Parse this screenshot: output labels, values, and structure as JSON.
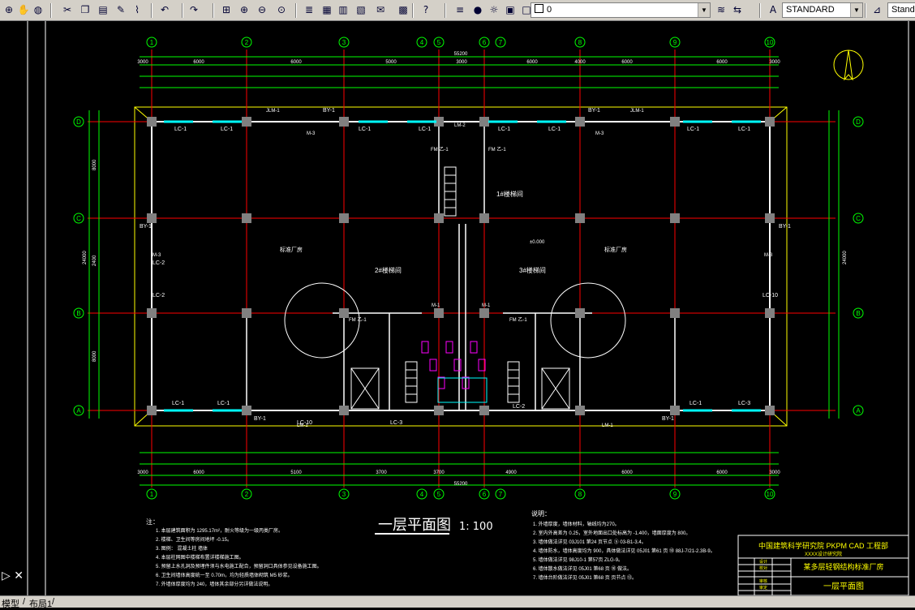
{
  "toolbar": {
    "layer_value": "0",
    "text_style": "STANDARD",
    "dim_style": "Stand",
    "icons": [
      "zoom-realtime-icon",
      "pan-icon",
      "globe-icon",
      "cut-icon",
      "copy-icon",
      "paste-icon",
      "match-properties-icon",
      "brush-icon",
      "undo-icon",
      "redo-icon",
      "zoom-window-icon",
      "zoom-in-icon",
      "zoom-out-icon",
      "zoom-previous-icon",
      "properties-icon",
      "design-center-icon",
      "tool-palette-icon",
      "sheet-set-icon",
      "markup-icon",
      "calculator-icon",
      "help-icon",
      "layer-manager-icon",
      "bulb-icon",
      "sun-icon",
      "lock-icon",
      "color-square-icon",
      "layer-state-icon",
      "layer-previous-icon",
      "text-style-icon",
      "dim-style-icon"
    ]
  },
  "status": {
    "model_tab": "模型",
    "layout_tab": "布局1"
  },
  "drawing": {
    "grid_top": [
      "1",
      "2",
      "3",
      "4",
      "5",
      "6",
      "7",
      "8",
      "9",
      "10"
    ],
    "grid_left": [
      "D",
      "C",
      "B",
      "A"
    ],
    "top_dims_total": "55200",
    "top_dims_row1": [
      "3000",
      "6000",
      "6000",
      "5000",
      "3000",
      "6000",
      "4000",
      "6000",
      "6000",
      "3000"
    ],
    "bottom_total": "55200",
    "bottom_dims_row1": [
      "3000",
      "6000",
      "5100",
      "3700",
      "3700",
      "4900",
      "6000",
      "6000",
      "3000"
    ],
    "left_dims": [
      "8000",
      "2400",
      "8000"
    ],
    "left_total": "24000",
    "right_total": "24000",
    "stair1": "1#楼梯间",
    "stair2": "2#楼梯间",
    "stair3": "3#楼梯间",
    "room_left": "标准厂房",
    "room_right": "标准厂房",
    "elev": "±0.000",
    "window_labels": [
      "LC-1",
      "LC-1",
      "LC-1",
      "LC-1",
      "LC-1",
      "LC-1",
      "LC-1",
      "LC-1",
      "LC-1",
      "LC-1",
      "LC-1",
      "LC-3",
      "LC-3",
      "LC-2",
      "LC-2",
      "LC-2",
      "LC-10",
      "LC-10"
    ],
    "bay_labels": [
      "BY-1",
      "BY-1",
      "BY-1",
      "BY-1",
      "BY-1",
      "BY-1"
    ],
    "door_labels": [
      "JLM-1",
      "JLM-1",
      "LM-2",
      "LM-1",
      "LM-1",
      "M-1",
      "M-1",
      "M-3",
      "M-3",
      "M-3",
      "M-3",
      "FM 乙-1",
      "FM 乙-1",
      "FM 乙-1",
      "FM 乙-1"
    ],
    "drawing_title": "一层平面图",
    "drawing_scale": "1: 100",
    "notes_left_heading": "注：",
    "notes_left": [
      "1. 本层建筑面积为 1295.17m²，耐火等级为一级丙类厂房。",
      "2. 楼梯、卫生间等房间地坪 -0.15。",
      "3. 图例：  混凝土柱  墙体",
      "4. 本层柱网图中楼梯布置详楼梯施工图。",
      "5. 预留上水孔洞及预埋件须与水电施工配合，预留洞口具体参见设备施工图。",
      "6. 卫生间墙体高度统一至 0.70m，均为轻质墙体砌筑 M5 砂浆。",
      "7. 外墙体厚度均为 240，墙体其余部分另详做法说明。"
    ],
    "notes_right_heading": "说明：",
    "notes_right": [
      "1. 外墙厚度，墙体材料，轴线均为270。",
      "2. 室内外高差为 0.25，室外地面出口处标高为 -1.400，墙面厚度为 800。",
      "3. 墙体做法详见 03J101 第24 页节点 ⑤ 03-B1-3.4。",
      "4. 墙体防水，墙体高度均为 900，具体做法详见 05J01 第61 页 ⑩ 88J-7/21-2.3B-9。",
      "5. 墙体做法详见 98J10-1 第57页 ZLG-9。",
      "6. 墙体散水做法详见 05J01 第68 页 ⑩ 做法。",
      "7. 墙体台阶做法详见 05J01 第68 页 页节点 ⑬。"
    ],
    "titleblock_org": "中国建筑科学研究院 PKPM CAD 工程部",
    "titleblock_sub": "XXXX设计研究院",
    "titleblock_project": "某多层轻钢结构标准厂房",
    "titleblock_sheet": "一层平面图",
    "titleblock_cells": [
      "设计",
      "校对",
      "审核",
      "审定"
    ]
  },
  "colors": {
    "grid": "#ff0000",
    "dim": "#00ff00",
    "wall": "#ffffff",
    "column": "#808080",
    "text": "#ffffff",
    "title": "#ffff00",
    "window": "#00ffff"
  }
}
